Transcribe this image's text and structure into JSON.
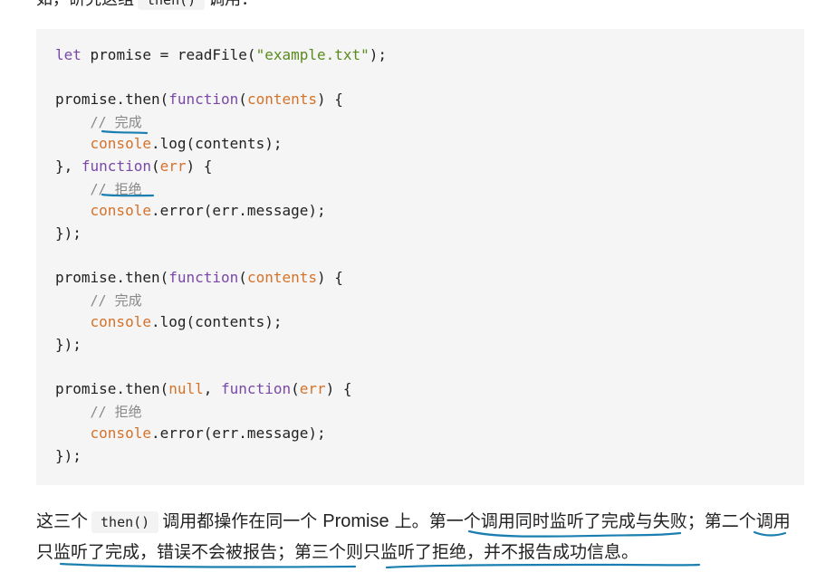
{
  "intro": {
    "text_before": "如，研究这组",
    "code": "then()",
    "text_after": "调用："
  },
  "code_lines": [
    "let promise = readFile(\"example.txt\");",
    "",
    "promise.then(function(contents) {",
    "    // 完成",
    "    console.log(contents);",
    "}, function(err) {",
    "    // 拒绝",
    "    console.error(err.message);",
    "});",
    "",
    "promise.then(function(contents) {",
    "    // 完成",
    "    console.log(contents);",
    "});",
    "",
    "promise.then(null, function(err) {",
    "    // 拒绝",
    "    console.error(err.message);",
    "});"
  ],
  "paragraph": {
    "part1": "这三个",
    "code": "then()",
    "part2": "调用都操作在同一个",
    "promise_word": "Promise",
    "part3": "上。",
    "sentence1": "第一个调用同时监听了完成与失败；",
    "sentence2_a": "第二",
    "sentence2_b": "个调用只监听了完成，错误不会被报告；",
    "sentence3": "第三个则只监听了拒绝，并不报告成功信息。"
  },
  "annotation_color": "#1a7fb0"
}
